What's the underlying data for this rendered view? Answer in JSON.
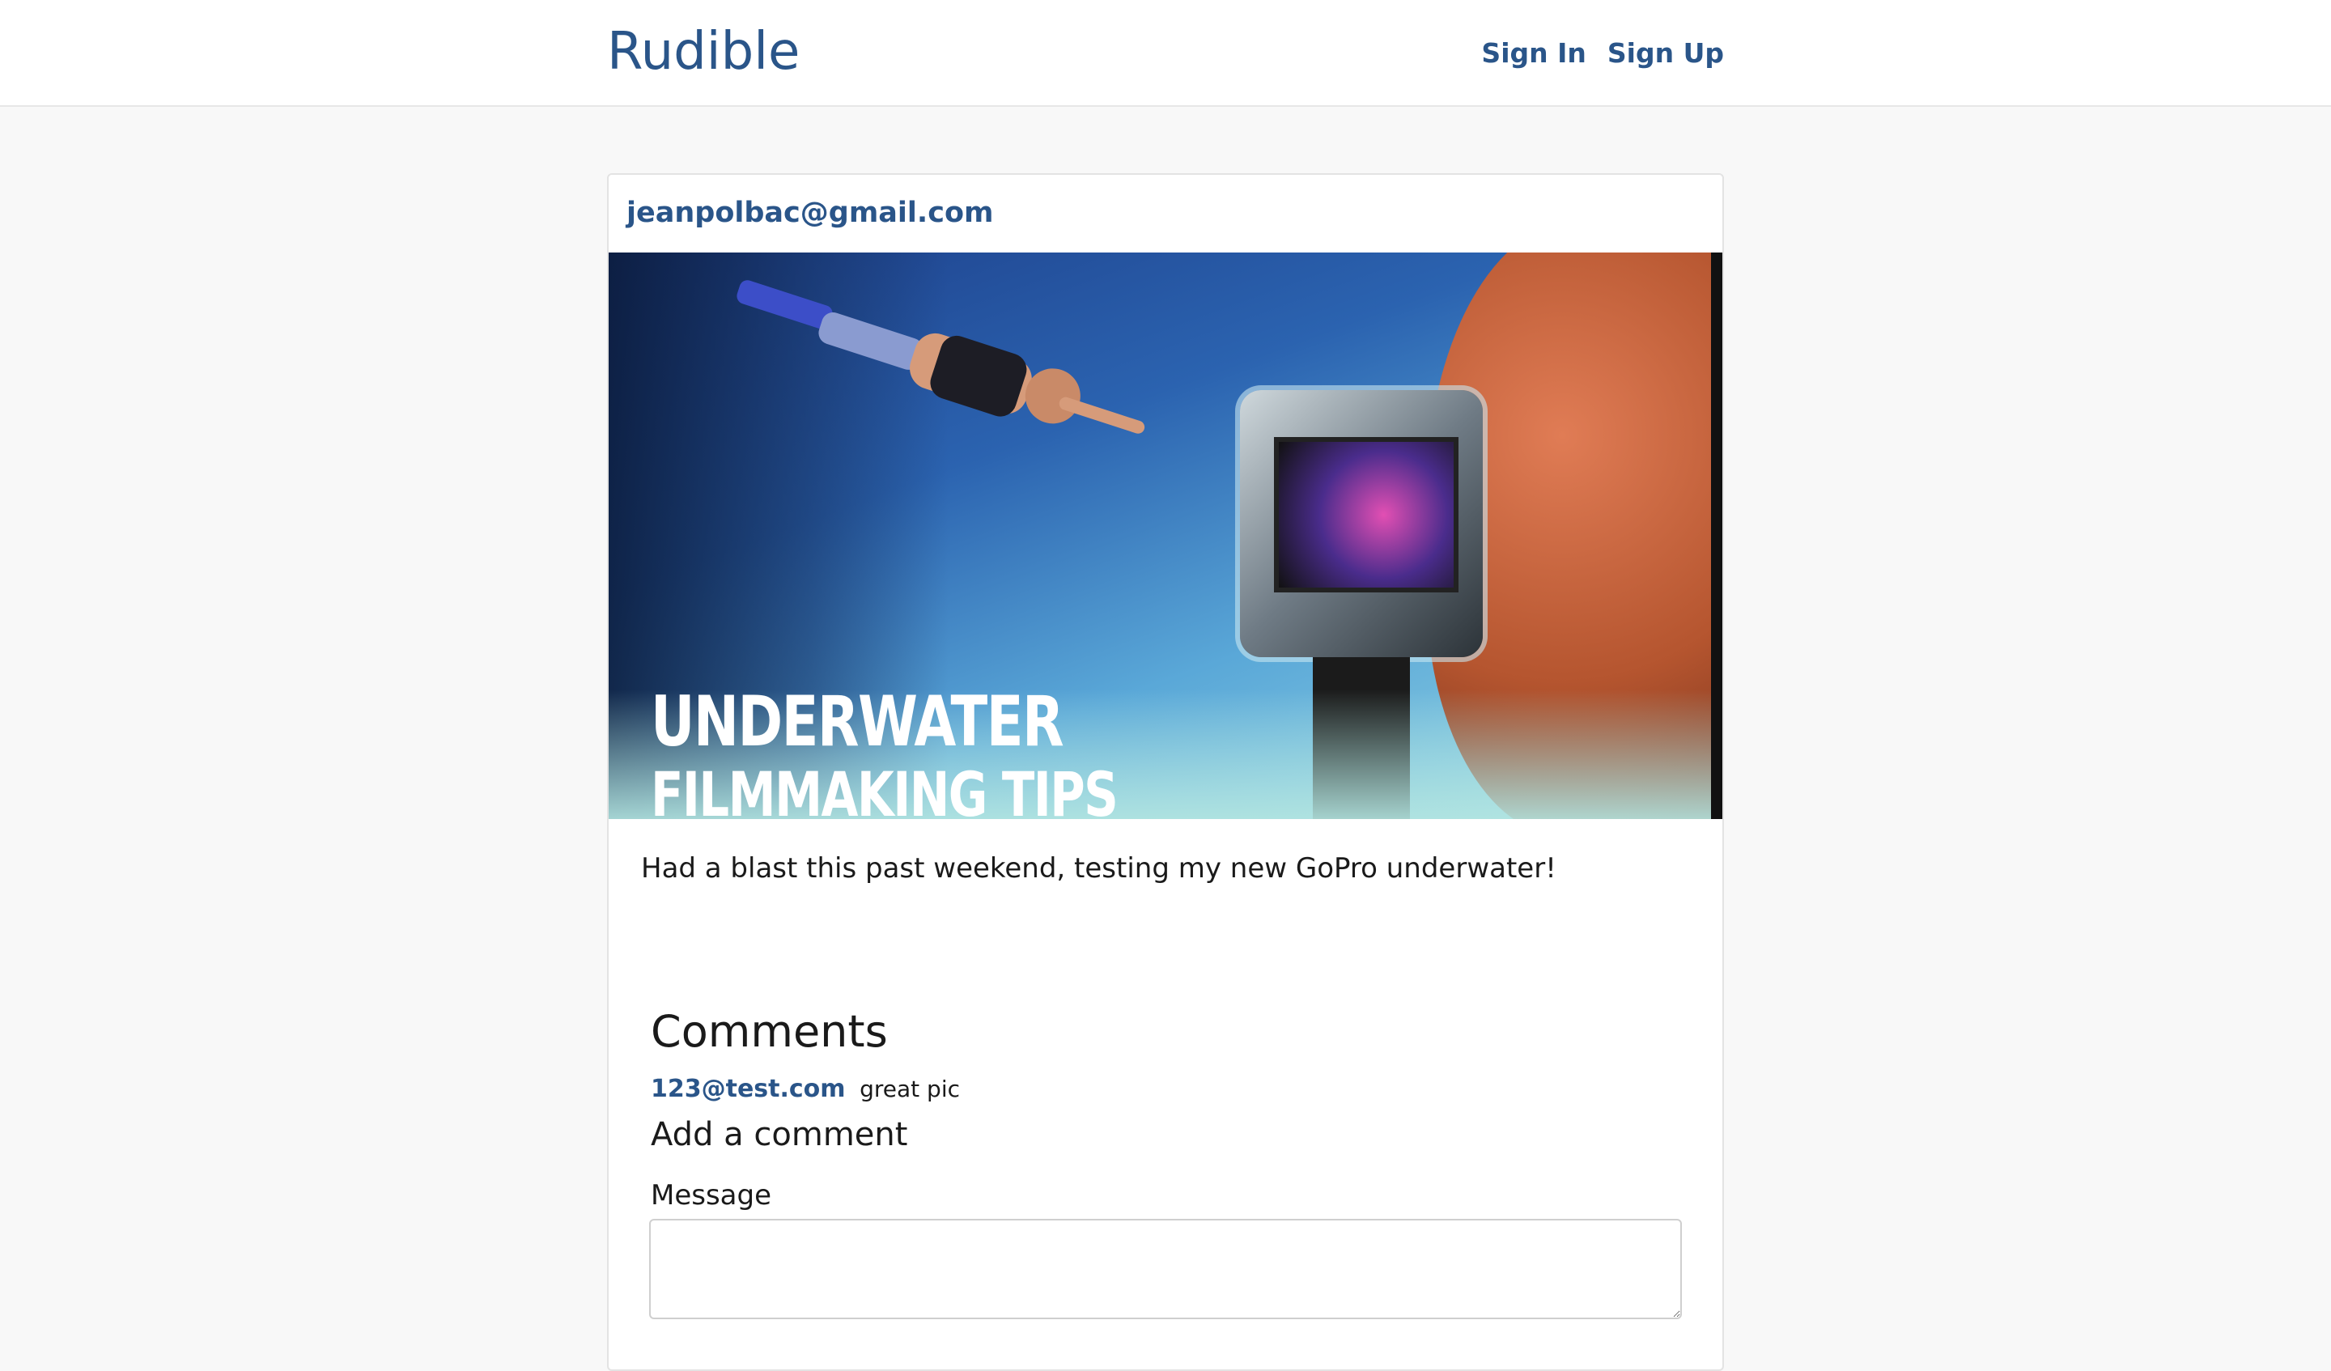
{
  "navbar": {
    "brand": "Rudible",
    "links": {
      "sign_in": "Sign In",
      "sign_up": "Sign Up"
    }
  },
  "post": {
    "author": "jeanpolbac@gmail.com",
    "image": {
      "overlay_line1": "UNDERWATER",
      "overlay_line2": "FILMMAKING TIPS"
    },
    "caption": "Had a blast this past weekend, testing my new GoPro underwater!"
  },
  "comments": {
    "title": "Comments",
    "items": [
      {
        "author": "123@test.com",
        "text": "great pic"
      }
    ]
  },
  "add_comment": {
    "title": "Add a comment",
    "message_label": "Message",
    "message_value": "",
    "message_placeholder": ""
  },
  "colors": {
    "brand": "#2a5589",
    "background": "#f8f8f8",
    "card": "#ffffff"
  }
}
